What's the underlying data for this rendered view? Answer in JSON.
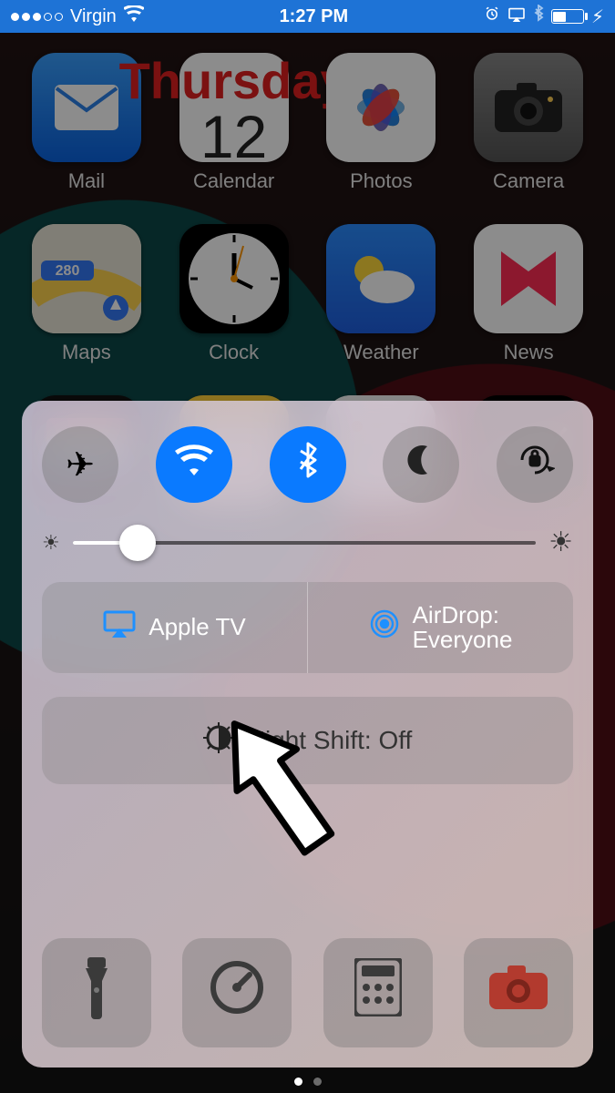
{
  "status": {
    "carrier": "Virgin",
    "time": "1:27 PM",
    "alarm_icon": "⏰",
    "airplay_icon": "▢",
    "bluetooth_icon": "✱",
    "charging_icon": "⚡︎"
  },
  "calendar_tile": {
    "weekday": "Thursday",
    "day": "12"
  },
  "apps": {
    "row1": [
      "Mail",
      "Calendar",
      "Photos",
      "Camera"
    ],
    "row2": [
      "Maps",
      "Clock",
      "Weather",
      "News"
    ]
  },
  "control_center": {
    "toggles": {
      "airplane": {
        "active": false
      },
      "wifi": {
        "active": true
      },
      "bluetooth": {
        "active": true
      },
      "dnd": {
        "active": false
      },
      "lock": {
        "active": false
      }
    },
    "brightness_percent": 14,
    "airplay_label": "Apple TV",
    "airdrop_label": "AirDrop:",
    "airdrop_value": "Everyone",
    "night_shift_label": "Night Shift: Off",
    "shortcuts": {
      "flashlight": "flashlight-icon",
      "timer": "timer-icon",
      "calculator": "calculator-icon",
      "camera": "camera-icon"
    }
  },
  "pager": {
    "count": 2,
    "active": 0
  }
}
